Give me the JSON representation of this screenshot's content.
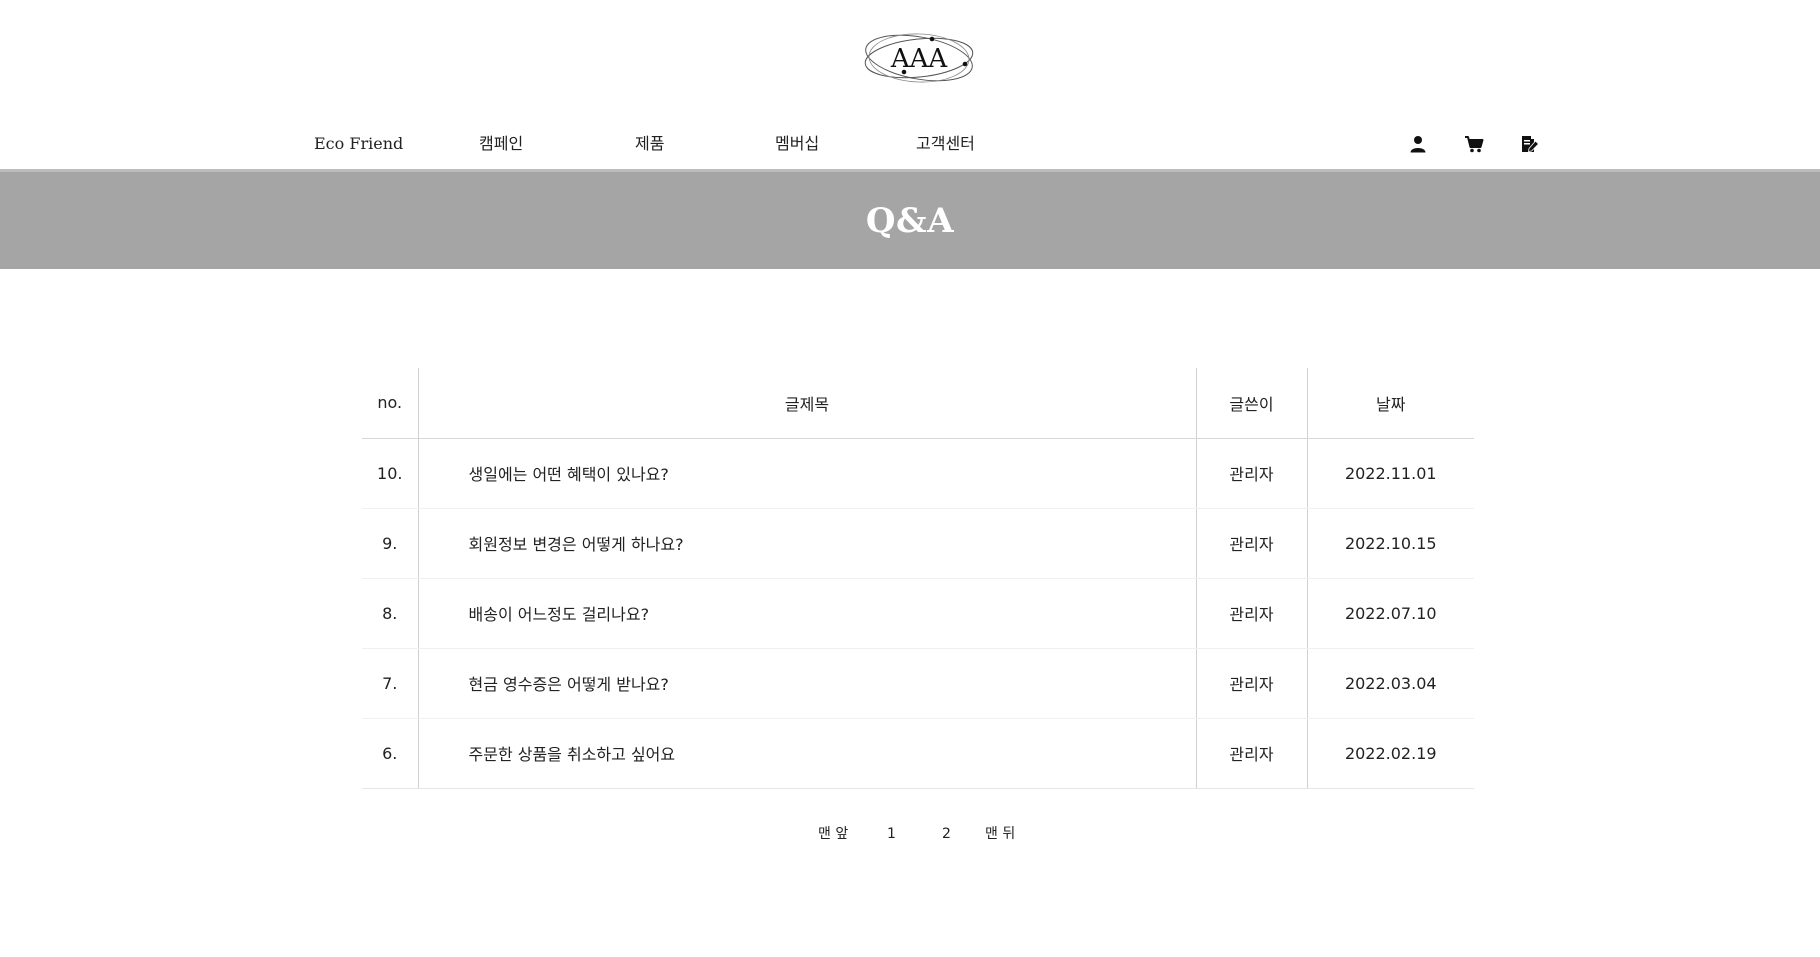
{
  "logo": {
    "text": "AAA",
    "icon": "atom-orbit-logo"
  },
  "nav": {
    "brand": "Eco Friend",
    "items": [
      "캠페인",
      "제품",
      "멤버십",
      "고객센터"
    ]
  },
  "header_icons": [
    "user-icon",
    "cart-icon",
    "write-icon"
  ],
  "banner": {
    "title": "Q&A",
    "background": "#a5a5a5"
  },
  "table": {
    "headers": {
      "no": "no.",
      "title": "글제목",
      "writer": "글쓴이",
      "date": "날짜"
    },
    "rows": [
      {
        "no": "10.",
        "title": "생일에는 어떤 혜택이 있나요?",
        "writer": "관리자",
        "date": "2022.11.01"
      },
      {
        "no": "9.",
        "title": "회원정보 변경은 어떻게 하나요?",
        "writer": "관리자",
        "date": "2022.10.15"
      },
      {
        "no": "8.",
        "title": "배송이 어느정도 걸리나요?",
        "writer": "관리자",
        "date": "2022.07.10"
      },
      {
        "no": "7.",
        "title": "현금 영수증은 어떻게 받나요?",
        "writer": "관리자",
        "date": "2022.03.04"
      },
      {
        "no": "6.",
        "title": "주문한 상품을 취소하고 싶어요",
        "writer": "관리자",
        "date": "2022.02.19"
      }
    ]
  },
  "pagination": {
    "first": "맨 앞",
    "pages": [
      "1",
      "2"
    ],
    "last": "맨 뒤"
  }
}
